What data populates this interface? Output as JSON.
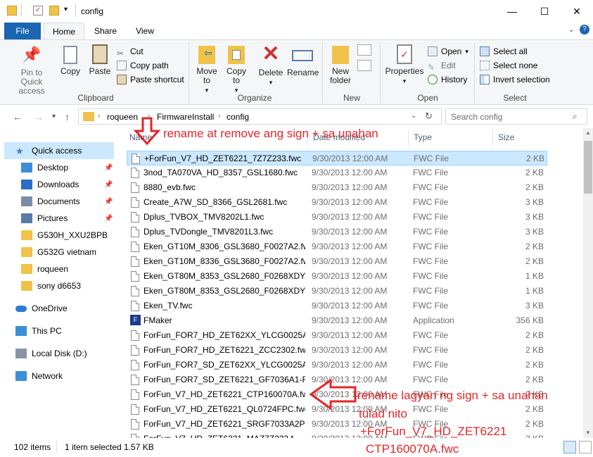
{
  "window": {
    "title": "config",
    "controls": {
      "minimize": "—",
      "maximize": "☐",
      "close": "✕"
    }
  },
  "ribbon_tabs": [
    "File",
    "Home",
    "Share",
    "View"
  ],
  "ribbon": {
    "clipboard": {
      "pin": "Pin to Quick access",
      "copy": "Copy",
      "paste": "Paste",
      "cut": "Cut",
      "copy_path": "Copy path",
      "paste_shortcut": "Paste shortcut",
      "label": "Clipboard"
    },
    "organize": {
      "move_to": "Move to",
      "copy_to": "Copy to",
      "delete": "Delete",
      "rename": "Rename",
      "label": "Organize"
    },
    "new": {
      "new_folder": "New folder",
      "label": "New"
    },
    "open": {
      "properties": "Properties",
      "open": "Open",
      "edit": "Edit",
      "history": "History",
      "label": "Open"
    },
    "select": {
      "select_all": "Select all",
      "select_none": "Select none",
      "invert": "Invert selection",
      "label": "Select"
    }
  },
  "address": {
    "crumbs": [
      "roqueen",
      "FirmwareInstall",
      "config"
    ],
    "search_placeholder": "Search config"
  },
  "nav": [
    {
      "label": "Quick access",
      "icon": "star-icon",
      "selected": true,
      "indent": 0
    },
    {
      "label": "Desktop",
      "icon": "desktop-icon",
      "pinned": true,
      "indent": 1
    },
    {
      "label": "Downloads",
      "icon": "download-icon",
      "pinned": true,
      "indent": 1
    },
    {
      "label": "Documents",
      "icon": "documents-icon",
      "pinned": true,
      "indent": 1
    },
    {
      "label": "Pictures",
      "icon": "pictures-icon",
      "pinned": true,
      "indent": 1
    },
    {
      "label": "G530H_XXU2BPB2_",
      "icon": "folder-icon",
      "indent": 1
    },
    {
      "label": "G532G vietnam",
      "icon": "folder-icon",
      "indent": 1
    },
    {
      "label": "roqueen",
      "icon": "folder-icon",
      "indent": 1
    },
    {
      "label": "sony d6653",
      "icon": "folder-icon",
      "indent": 1
    },
    {
      "label": "OneDrive",
      "icon": "cloud-icon",
      "indent": 0
    },
    {
      "label": "This PC",
      "icon": "pc-icon",
      "indent": 0
    },
    {
      "label": "Local Disk (D:)",
      "icon": "drive-icon",
      "indent": 0
    },
    {
      "label": "Network",
      "icon": "network-icon",
      "indent": 0
    }
  ],
  "columns": {
    "name": "Name",
    "date": "Date modified",
    "type": "Type",
    "size": "Size"
  },
  "files": [
    {
      "name": "+ForFun_V7_HD_ZET6221_7Z7Z233.fwc",
      "date": "9/30/2013 12:00 AM",
      "type": "FWC File",
      "size": "2 KB",
      "selected": true
    },
    {
      "name": "3nod_TA070VA_HD_8357_GSL1680.fwc",
      "date": "9/30/2013 12:00 AM",
      "type": "FWC File",
      "size": "2 KB"
    },
    {
      "name": "8880_evb.fwc",
      "date": "9/30/2013 12:00 AM",
      "type": "FWC File",
      "size": "2 KB"
    },
    {
      "name": "Create_A7W_SD_8366_GSL2681.fwc",
      "date": "9/30/2013 12:00 AM",
      "type": "FWC File",
      "size": "3 KB"
    },
    {
      "name": "Dplus_TVBOX_TMV8202L1.fwc",
      "date": "9/30/2013 12:00 AM",
      "type": "FWC File",
      "size": "3 KB"
    },
    {
      "name": "Dplus_TVDongle_TMV8201L3.fwc",
      "date": "9/30/2013 12:00 AM",
      "type": "FWC File",
      "size": "3 KB"
    },
    {
      "name": "Eken_GT10M_8306_GSL3680_F0027A2.fwc",
      "date": "9/30/2013 12:00 AM",
      "type": "FWC File",
      "size": "2 KB"
    },
    {
      "name": "Eken_GT10M_8336_GSL3680_F0027A2.fwc",
      "date": "9/30/2013 12:00 AM",
      "type": "FWC File",
      "size": "2 KB"
    },
    {
      "name": "Eken_GT80M_8353_GSL2680_F0268XDY.fwc",
      "date": "9/30/2013 12:00 AM",
      "type": "FWC File",
      "size": "1 KB"
    },
    {
      "name": "Eken_GT80M_8353_GSL2680_F0268XDY-i.f...",
      "date": "9/30/2013 12:00 AM",
      "type": "FWC File",
      "size": "1 KB"
    },
    {
      "name": "Eken_TV.fwc",
      "date": "9/30/2013 12:00 AM",
      "type": "FWC File",
      "size": "3 KB"
    },
    {
      "name": "FMaker",
      "date": "9/30/2013 12:00 AM",
      "type": "Application",
      "size": "356 KB",
      "app": true
    },
    {
      "name": "ForFun_FOR7_HD_ZET62XX_YLCG0025A1....",
      "date": "9/30/2013 12:00 AM",
      "type": "FWC File",
      "size": "2 KB"
    },
    {
      "name": "ForFun_FOR7_HD_ZET6221_ZCC2302.fwc",
      "date": "9/30/2013 12:00 AM",
      "type": "FWC File",
      "size": "2 KB"
    },
    {
      "name": "ForFun_FOR7_SD_ZET62XX_YLCG0025A1....",
      "date": "9/30/2013 12:00 AM",
      "type": "FWC File",
      "size": "2 KB"
    },
    {
      "name": "ForFun_FOR7_SD_ZET6221_GF7036A1-FP...",
      "date": "9/30/2013 12:00 AM",
      "type": "FWC File",
      "size": "2 KB"
    },
    {
      "name": "ForFun_V7_HD_ZET6221_CTP160070A.fwc",
      "date": "9/30/2013 12:00 AM",
      "type": "FWC File",
      "size": "2 KB"
    },
    {
      "name": "ForFun_V7_HD_ZET6221_QL0724FPC.fwc",
      "date": "9/30/2013 12:00 AM",
      "type": "FWC File",
      "size": "2 KB"
    },
    {
      "name": "ForFun_V7_HD_ZET6221_SRGF7033A2PG.f...",
      "date": "9/30/2013 12:00 AM",
      "type": "FWC File",
      "size": "2 KB"
    },
    {
      "name": "ForFun_V7_HD_ZET6221_MAZ7Z233.f...",
      "date": "9/30/2013 12:00 AM",
      "type": "FWC File",
      "size": "2 KB"
    }
  ],
  "status": {
    "items": "102 items",
    "selected": "1 item selected",
    "size": "1.57 KB"
  },
  "annotations": {
    "top": "rename at remove ang sign + sa unahan",
    "bottom_line1": "rename lagyan ng sign + sa unahan",
    "bottom_line2": "tulad nito",
    "bottom_line3": "+ForFun_V7_HD_ZET6221",
    "bottom_line4": "CTP160070A.fwc",
    "color": "#e3262a"
  }
}
